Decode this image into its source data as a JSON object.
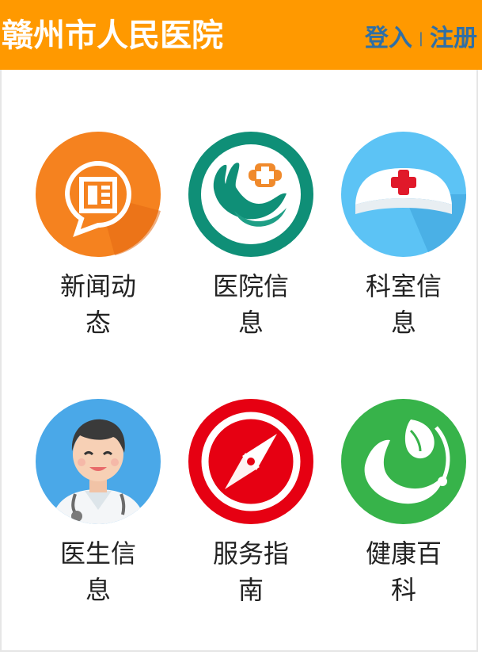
{
  "header": {
    "title": "赣州市人民医院",
    "login": "登入",
    "separator": "|",
    "register": "注册"
  },
  "colors": {
    "header_bg": "#ff9900",
    "link": "#2f6fa6",
    "news": "#f5821f",
    "hospital": "#0f8f77",
    "dept": "#5cc3f5",
    "doctor": "#4aa8e8",
    "guide": "#e60012",
    "health": "#37b34a"
  },
  "tiles": [
    {
      "label": "新闻动态",
      "icon": "news-icon"
    },
    {
      "label": "医院信息",
      "icon": "hospital-hand-icon"
    },
    {
      "label": "科室信息",
      "icon": "nurse-cap-icon"
    },
    {
      "label": "医生信息",
      "icon": "doctor-avatar-icon"
    },
    {
      "label": "服务指南",
      "icon": "compass-icon"
    },
    {
      "label": "健康百科",
      "icon": "leaf-hand-icon"
    }
  ]
}
